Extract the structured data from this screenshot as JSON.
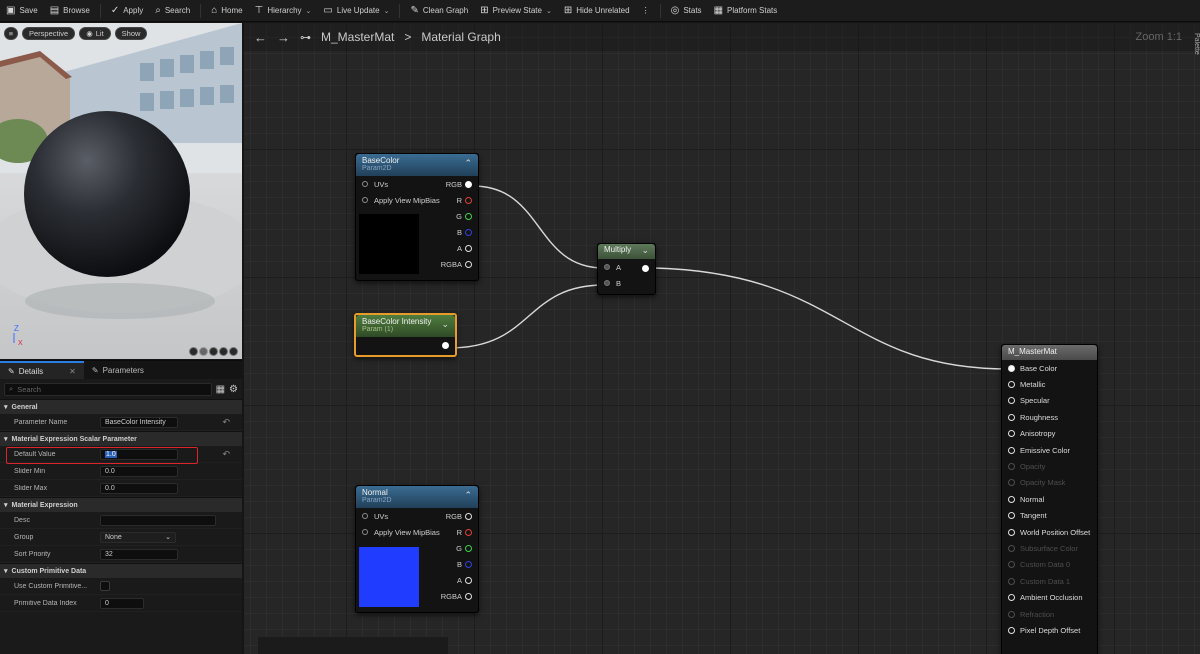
{
  "toolbar": {
    "items": [
      {
        "label": "Save",
        "icon": "save-icon",
        "glyph": "▣"
      },
      {
        "label": "Browse",
        "icon": "folder-icon",
        "glyph": "▤"
      },
      {
        "label": "Apply",
        "icon": "check-icon",
        "glyph": "✓"
      },
      {
        "label": "Search",
        "icon": "binoculars-icon",
        "glyph": "⌕"
      },
      {
        "label": "Home",
        "icon": "home-icon",
        "glyph": "⌂"
      },
      {
        "label": "Hierarchy",
        "icon": "hierarchy-icon",
        "glyph": "⊤"
      },
      {
        "label": "Live Update",
        "icon": "live-update-icon",
        "glyph": "▭"
      },
      {
        "label": "Clean Graph",
        "icon": "broom-icon",
        "glyph": "✎"
      },
      {
        "label": "Preview State",
        "icon": "preview-state-icon",
        "glyph": "⊞"
      },
      {
        "label": "Hide Unrelated",
        "icon": "hide-unrelated-icon",
        "glyph": "⊞"
      },
      {
        "label": "Stats",
        "icon": "stats-icon",
        "glyph": "◎"
      },
      {
        "label": "Platform Stats",
        "icon": "platform-stats-icon",
        "glyph": "▦"
      }
    ]
  },
  "viewport": {
    "perspective_label": "Perspective",
    "lit_label": "Lit",
    "show_label": "Show"
  },
  "details": {
    "tab_details": "Details",
    "tab_parameters": "Parameters",
    "search_placeholder": "Search",
    "sections": {
      "general": "General",
      "scalar_param": "Material Expression Scalar Parameter",
      "material_expression": "Material Expression",
      "custom_primitive": "Custom Primitive Data"
    },
    "rows": {
      "parameter_name_label": "Parameter Name",
      "parameter_name_value": "BaseColor Intensity",
      "default_value_label": "Default Value",
      "default_value_value": "1.0",
      "slider_min_label": "Slider Min",
      "slider_min_value": "0.0",
      "slider_max_label": "Slider Max",
      "slider_max_value": "0.0",
      "desc_label": "Desc",
      "group_label": "Group",
      "group_value": "None",
      "sort_priority_label": "Sort Priority",
      "sort_priority_value": "32",
      "use_custom_primitive_label": "Use Custom Primitive...",
      "primitive_data_index_label": "Primitive Data Index",
      "primitive_data_index_value": "0"
    }
  },
  "graph": {
    "material_name": "M_MasterMat",
    "breadcrumb_sep": ">",
    "graph_name": "Material Graph",
    "zoom": "Zoom 1:1",
    "palette_label": "Palette",
    "nodes": {
      "basecolor": {
        "title": "BaseColor",
        "subtitle": "Param2D"
      },
      "intensity": {
        "title": "BaseColor Intensity",
        "subtitle": "Param (1)"
      },
      "multiply": {
        "title": "Multiply"
      },
      "normal": {
        "title": "Normal",
        "subtitle": "Param2D"
      },
      "result": {
        "title": "M_MasterMat"
      }
    },
    "texture_inputs": [
      "UVs",
      "Apply View MipBias"
    ],
    "texture_outputs": [
      "RGB",
      "R",
      "G",
      "B",
      "A",
      "RGBA"
    ],
    "multiply_inputs": [
      "A",
      "B"
    ],
    "result_pins": [
      {
        "label": "Base Color",
        "state": "on"
      },
      {
        "label": "Metallic",
        "state": "active"
      },
      {
        "label": "Specular",
        "state": "active"
      },
      {
        "label": "Roughness",
        "state": "active"
      },
      {
        "label": "Anisotropy",
        "state": "active"
      },
      {
        "label": "Emissive Color",
        "state": "active"
      },
      {
        "label": "Opacity",
        "state": "dim"
      },
      {
        "label": "Opacity Mask",
        "state": "dim"
      },
      {
        "label": "Normal",
        "state": "active"
      },
      {
        "label": "Tangent",
        "state": "active"
      },
      {
        "label": "World Position Offset",
        "state": "active"
      },
      {
        "label": "Subsurface Color",
        "state": "dim"
      },
      {
        "label": "Custom Data 0",
        "state": "dim"
      },
      {
        "label": "Custom Data 1",
        "state": "dim"
      },
      {
        "label": "Ambient Occlusion",
        "state": "active"
      },
      {
        "label": "Refraction",
        "state": "dim"
      },
      {
        "label": "Pixel Depth Offset",
        "state": "active"
      }
    ],
    "colors": {
      "wire": "#d9d9d9",
      "pin_r": "#e0403a",
      "pin_g": "#3fd24a",
      "pin_b": "#2f42e0",
      "basecolor_preview": "#000000",
      "normal_preview": "#1f3cff",
      "selection_orange": "#e79b2b",
      "highlight_red": "#d9262b"
    }
  }
}
